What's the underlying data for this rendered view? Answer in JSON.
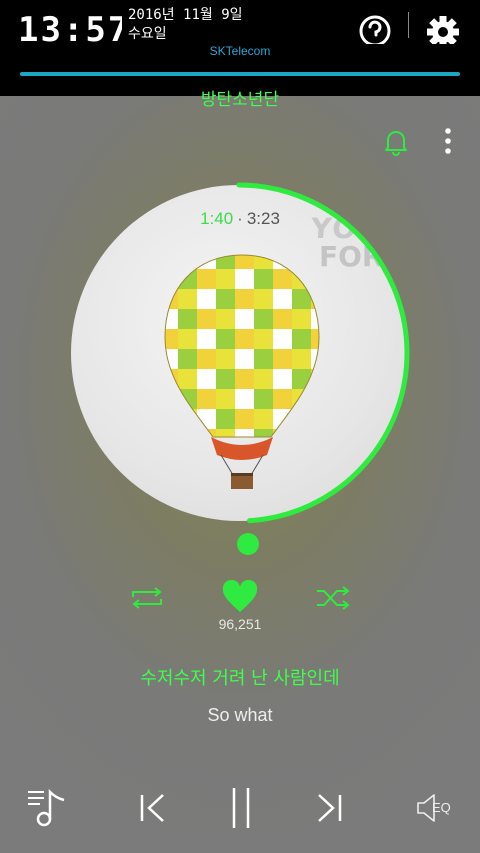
{
  "status_bar": {
    "time": "13:57",
    "date": "2016년 11월 9일",
    "day": "수요일",
    "carrier": "SKTelecom"
  },
  "player": {
    "artist": "방탄소년단",
    "elapsed": "1:40",
    "separator": "·",
    "duration": "3:23",
    "progress_fraction": 0.49,
    "album_text_line1": "YOU",
    "album_text_line2": "FOREVER",
    "like_count": "96,251",
    "lyric_current": "수저수저 거려 난 사람인데",
    "lyric_next": "So what",
    "eq_label": "EQ"
  },
  "colors": {
    "accent": "#2fea3f",
    "status_bar_bg": "#000000",
    "carrier_text": "#29a8d6"
  },
  "icons": {
    "help": "help-circle-icon",
    "settings": "gear-icon",
    "bell": "bell-icon",
    "more": "more-vertical-icon",
    "repeat": "repeat-icon",
    "like": "heart-icon",
    "shuffle": "shuffle-icon",
    "playlist": "playlist-icon",
    "previous": "skip-previous-icon",
    "pause": "pause-icon",
    "next": "skip-next-icon",
    "equalizer": "equalizer-icon"
  }
}
